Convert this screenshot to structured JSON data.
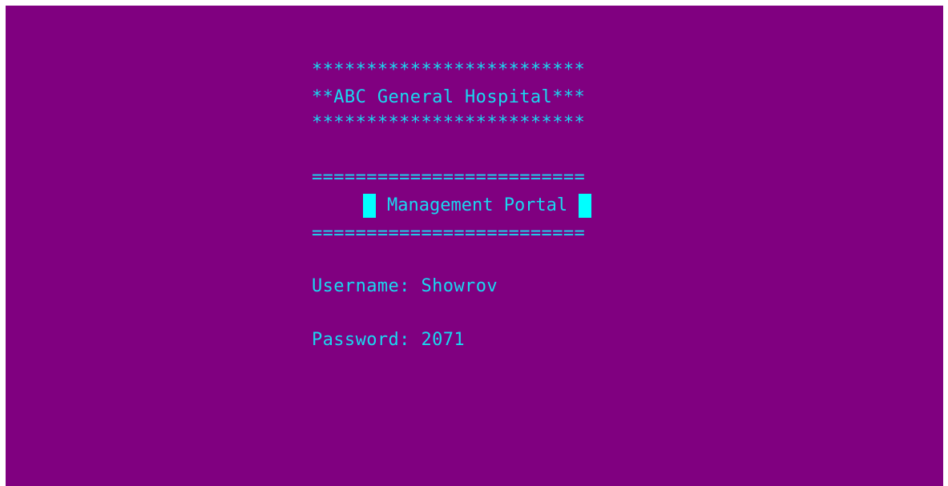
{
  "banner": {
    "stars_top": "*************************",
    "hospital_line": "**ABC General Hospital***",
    "stars_bottom": "*************************"
  },
  "portal": {
    "rule_top": "=========================",
    "title": "Management Portal",
    "rule_bottom": "========================="
  },
  "login": {
    "username_label": "Username:",
    "username_value": "Showrov",
    "password_label": "Password:",
    "password_value": "2071"
  },
  "colors": {
    "background": "#800080",
    "text": "#19d8f0",
    "block": "#00ffff"
  }
}
